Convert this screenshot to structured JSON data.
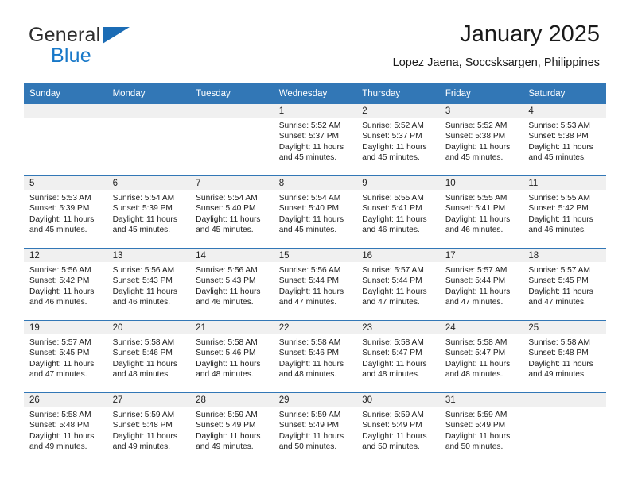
{
  "brand": {
    "name_part1": "General",
    "name_part2": "Blue",
    "logo_icon": "triangle-logo-icon",
    "accent_color": "#1878c8",
    "triangle_color": "#1b6cb5"
  },
  "header": {
    "title": "January 2025",
    "subtitle": "Lopez Jaena, Soccsksargen, Philippines"
  },
  "theme": {
    "header_row_color": "#3277b6",
    "daynum_band_color": "#f0f0f0",
    "separator_color": "#3277b6"
  },
  "calendar": {
    "weekday_headers": [
      "Sunday",
      "Monday",
      "Tuesday",
      "Wednesday",
      "Thursday",
      "Friday",
      "Saturday"
    ],
    "weeks": [
      [
        {
          "day": "",
          "empty": true,
          "lines": []
        },
        {
          "day": "",
          "empty": true,
          "lines": []
        },
        {
          "day": "",
          "empty": true,
          "lines": []
        },
        {
          "day": "1",
          "empty": false,
          "lines": [
            "Sunrise: 5:52 AM",
            "Sunset: 5:37 PM",
            "Daylight: 11 hours",
            "and 45 minutes."
          ]
        },
        {
          "day": "2",
          "empty": false,
          "lines": [
            "Sunrise: 5:52 AM",
            "Sunset: 5:37 PM",
            "Daylight: 11 hours",
            "and 45 minutes."
          ]
        },
        {
          "day": "3",
          "empty": false,
          "lines": [
            "Sunrise: 5:52 AM",
            "Sunset: 5:38 PM",
            "Daylight: 11 hours",
            "and 45 minutes."
          ]
        },
        {
          "day": "4",
          "empty": false,
          "lines": [
            "Sunrise: 5:53 AM",
            "Sunset: 5:38 PM",
            "Daylight: 11 hours",
            "and 45 minutes."
          ]
        }
      ],
      [
        {
          "day": "5",
          "empty": false,
          "lines": [
            "Sunrise: 5:53 AM",
            "Sunset: 5:39 PM",
            "Daylight: 11 hours",
            "and 45 minutes."
          ]
        },
        {
          "day": "6",
          "empty": false,
          "lines": [
            "Sunrise: 5:54 AM",
            "Sunset: 5:39 PM",
            "Daylight: 11 hours",
            "and 45 minutes."
          ]
        },
        {
          "day": "7",
          "empty": false,
          "lines": [
            "Sunrise: 5:54 AM",
            "Sunset: 5:40 PM",
            "Daylight: 11 hours",
            "and 45 minutes."
          ]
        },
        {
          "day": "8",
          "empty": false,
          "lines": [
            "Sunrise: 5:54 AM",
            "Sunset: 5:40 PM",
            "Daylight: 11 hours",
            "and 45 minutes."
          ]
        },
        {
          "day": "9",
          "empty": false,
          "lines": [
            "Sunrise: 5:55 AM",
            "Sunset: 5:41 PM",
            "Daylight: 11 hours",
            "and 46 minutes."
          ]
        },
        {
          "day": "10",
          "empty": false,
          "lines": [
            "Sunrise: 5:55 AM",
            "Sunset: 5:41 PM",
            "Daylight: 11 hours",
            "and 46 minutes."
          ]
        },
        {
          "day": "11",
          "empty": false,
          "lines": [
            "Sunrise: 5:55 AM",
            "Sunset: 5:42 PM",
            "Daylight: 11 hours",
            "and 46 minutes."
          ]
        }
      ],
      [
        {
          "day": "12",
          "empty": false,
          "lines": [
            "Sunrise: 5:56 AM",
            "Sunset: 5:42 PM",
            "Daylight: 11 hours",
            "and 46 minutes."
          ]
        },
        {
          "day": "13",
          "empty": false,
          "lines": [
            "Sunrise: 5:56 AM",
            "Sunset: 5:43 PM",
            "Daylight: 11 hours",
            "and 46 minutes."
          ]
        },
        {
          "day": "14",
          "empty": false,
          "lines": [
            "Sunrise: 5:56 AM",
            "Sunset: 5:43 PM",
            "Daylight: 11 hours",
            "and 46 minutes."
          ]
        },
        {
          "day": "15",
          "empty": false,
          "lines": [
            "Sunrise: 5:56 AM",
            "Sunset: 5:44 PM",
            "Daylight: 11 hours",
            "and 47 minutes."
          ]
        },
        {
          "day": "16",
          "empty": false,
          "lines": [
            "Sunrise: 5:57 AM",
            "Sunset: 5:44 PM",
            "Daylight: 11 hours",
            "and 47 minutes."
          ]
        },
        {
          "day": "17",
          "empty": false,
          "lines": [
            "Sunrise: 5:57 AM",
            "Sunset: 5:44 PM",
            "Daylight: 11 hours",
            "and 47 minutes."
          ]
        },
        {
          "day": "18",
          "empty": false,
          "lines": [
            "Sunrise: 5:57 AM",
            "Sunset: 5:45 PM",
            "Daylight: 11 hours",
            "and 47 minutes."
          ]
        }
      ],
      [
        {
          "day": "19",
          "empty": false,
          "lines": [
            "Sunrise: 5:57 AM",
            "Sunset: 5:45 PM",
            "Daylight: 11 hours",
            "and 47 minutes."
          ]
        },
        {
          "day": "20",
          "empty": false,
          "lines": [
            "Sunrise: 5:58 AM",
            "Sunset: 5:46 PM",
            "Daylight: 11 hours",
            "and 48 minutes."
          ]
        },
        {
          "day": "21",
          "empty": false,
          "lines": [
            "Sunrise: 5:58 AM",
            "Sunset: 5:46 PM",
            "Daylight: 11 hours",
            "and 48 minutes."
          ]
        },
        {
          "day": "22",
          "empty": false,
          "lines": [
            "Sunrise: 5:58 AM",
            "Sunset: 5:46 PM",
            "Daylight: 11 hours",
            "and 48 minutes."
          ]
        },
        {
          "day": "23",
          "empty": false,
          "lines": [
            "Sunrise: 5:58 AM",
            "Sunset: 5:47 PM",
            "Daylight: 11 hours",
            "and 48 minutes."
          ]
        },
        {
          "day": "24",
          "empty": false,
          "lines": [
            "Sunrise: 5:58 AM",
            "Sunset: 5:47 PM",
            "Daylight: 11 hours",
            "and 48 minutes."
          ]
        },
        {
          "day": "25",
          "empty": false,
          "lines": [
            "Sunrise: 5:58 AM",
            "Sunset: 5:48 PM",
            "Daylight: 11 hours",
            "and 49 minutes."
          ]
        }
      ],
      [
        {
          "day": "26",
          "empty": false,
          "lines": [
            "Sunrise: 5:58 AM",
            "Sunset: 5:48 PM",
            "Daylight: 11 hours",
            "and 49 minutes."
          ]
        },
        {
          "day": "27",
          "empty": false,
          "lines": [
            "Sunrise: 5:59 AM",
            "Sunset: 5:48 PM",
            "Daylight: 11 hours",
            "and 49 minutes."
          ]
        },
        {
          "day": "28",
          "empty": false,
          "lines": [
            "Sunrise: 5:59 AM",
            "Sunset: 5:49 PM",
            "Daylight: 11 hours",
            "and 49 minutes."
          ]
        },
        {
          "day": "29",
          "empty": false,
          "lines": [
            "Sunrise: 5:59 AM",
            "Sunset: 5:49 PM",
            "Daylight: 11 hours",
            "and 50 minutes."
          ]
        },
        {
          "day": "30",
          "empty": false,
          "lines": [
            "Sunrise: 5:59 AM",
            "Sunset: 5:49 PM",
            "Daylight: 11 hours",
            "and 50 minutes."
          ]
        },
        {
          "day": "31",
          "empty": false,
          "lines": [
            "Sunrise: 5:59 AM",
            "Sunset: 5:49 PM",
            "Daylight: 11 hours",
            "and 50 minutes."
          ]
        },
        {
          "day": "",
          "empty": true,
          "lines": []
        }
      ]
    ]
  }
}
